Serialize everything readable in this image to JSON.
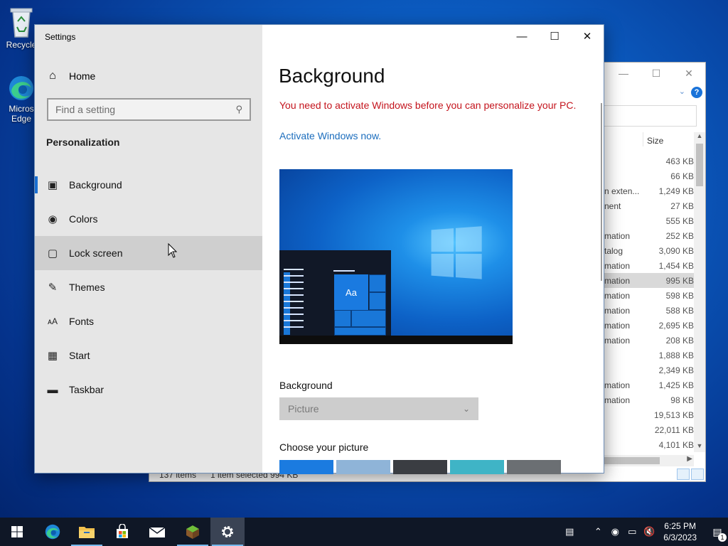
{
  "desktop": {
    "recycle_bin_label": "Recycle",
    "edge_label_1": "Micros",
    "edge_label_2": "Edge"
  },
  "explorer": {
    "column_size": "Size",
    "rows": [
      {
        "type": "",
        "size": "463 KB"
      },
      {
        "type": "",
        "size": "66 KB"
      },
      {
        "type": "n exten...",
        "size": "1,249 KB"
      },
      {
        "type": "nent",
        "size": "27 KB"
      },
      {
        "type": "",
        "size": "555 KB"
      },
      {
        "type": "mation",
        "size": "252 KB"
      },
      {
        "type": "talog",
        "size": "3,090 KB"
      },
      {
        "type": "mation",
        "size": "1,454 KB"
      },
      {
        "type": "mation",
        "size": "995 KB",
        "selected": true
      },
      {
        "type": "mation",
        "size": "598 KB"
      },
      {
        "type": "mation",
        "size": "588 KB"
      },
      {
        "type": "mation",
        "size": "2,695 KB"
      },
      {
        "type": "mation",
        "size": "208 KB"
      },
      {
        "type": "",
        "size": "1,888 KB"
      },
      {
        "type": "",
        "size": "2,349 KB"
      },
      {
        "type": "mation",
        "size": "1,425 KB"
      },
      {
        "type": "mation",
        "size": "98 KB"
      },
      {
        "type": "",
        "size": "19,513 KB"
      },
      {
        "type": "",
        "size": "22,011 KB"
      },
      {
        "type": "",
        "size": "4,101 KB"
      }
    ],
    "status_items": "137 items",
    "status_selected": "1 item selected  994 KB"
  },
  "settings": {
    "window_title": "Settings",
    "home_label": "Home",
    "search_placeholder": "Find a setting",
    "section_title": "Personalization",
    "nav": [
      {
        "label": "Background",
        "icon": "picture-icon"
      },
      {
        "label": "Colors",
        "icon": "palette-icon"
      },
      {
        "label": "Lock screen",
        "icon": "lock-screen-icon"
      },
      {
        "label": "Themes",
        "icon": "themes-icon"
      },
      {
        "label": "Fonts",
        "icon": "fonts-icon"
      },
      {
        "label": "Start",
        "icon": "start-icon"
      },
      {
        "label": "Taskbar",
        "icon": "taskbar-icon"
      }
    ],
    "page_title": "Background",
    "activation_warning": "You need to activate Windows before you can personalize your PC.",
    "activate_link": "Activate Windows now.",
    "preview_tile_text": "Aa",
    "background_label": "Background",
    "background_value": "Picture",
    "choose_picture_label": "Choose your picture",
    "thumbnail_colors": [
      "#1b7be0",
      "#8fb4d8",
      "#3a3d42",
      "#3fb4c6",
      "#6b6f73"
    ]
  },
  "taskbar": {
    "time": "6:25 PM",
    "date": "6/3/2023",
    "notification_count": "1",
    "accent": "#76b9ed"
  },
  "colors": {
    "warning": "#c4141d",
    "link": "#1b6dbd",
    "accent": "#1a6fd1"
  }
}
